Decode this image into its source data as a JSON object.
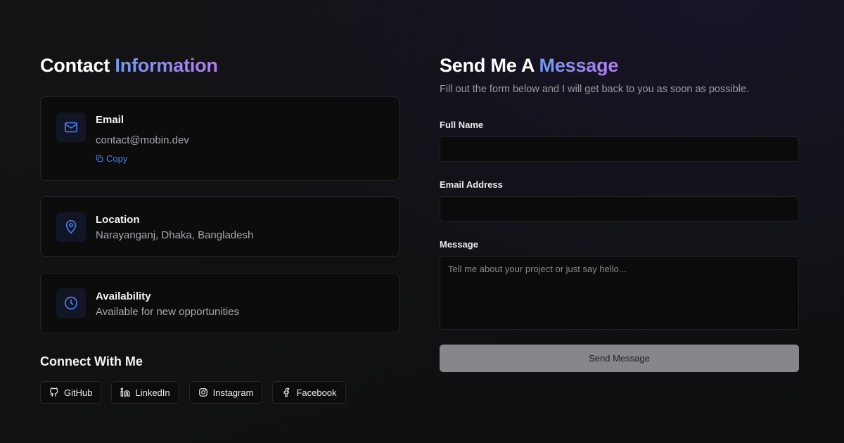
{
  "colors": {
    "accent_blue": "#4a7ef0",
    "gradient_start": "#6f9bf2",
    "gradient_end": "#b07ef0",
    "button_bg": "#86868b"
  },
  "contact": {
    "heading_plain": "Contact",
    "heading_accent": "Information",
    "email": {
      "icon": "mail-icon",
      "title": "Email",
      "value": "contact@mobin.dev",
      "copy_label": "Copy"
    },
    "location": {
      "icon": "map-pin-icon",
      "title": "Location",
      "value": "Narayanganj, Dhaka, Bangladesh"
    },
    "availability": {
      "icon": "clock-icon",
      "title": "Availability",
      "value": "Available for new opportunities"
    }
  },
  "connect": {
    "title": "Connect With Me",
    "links": [
      {
        "icon": "github-icon",
        "label": "GitHub"
      },
      {
        "icon": "linkedin-icon",
        "label": "LinkedIn"
      },
      {
        "icon": "instagram-icon",
        "label": "Instagram"
      },
      {
        "icon": "facebook-icon",
        "label": "Facebook"
      }
    ]
  },
  "form": {
    "heading_plain": "Send Me A",
    "heading_accent": "Message",
    "subtitle": "Fill out the form below and I will get back to you as soon as possible.",
    "full_name": {
      "label": "Full Name",
      "value": "",
      "placeholder": ""
    },
    "email": {
      "label": "Email Address",
      "value": "",
      "placeholder": ""
    },
    "message": {
      "label": "Message",
      "value": "",
      "placeholder": "Tell me about your project or just say hello..."
    },
    "submit_label": "Send Message"
  }
}
